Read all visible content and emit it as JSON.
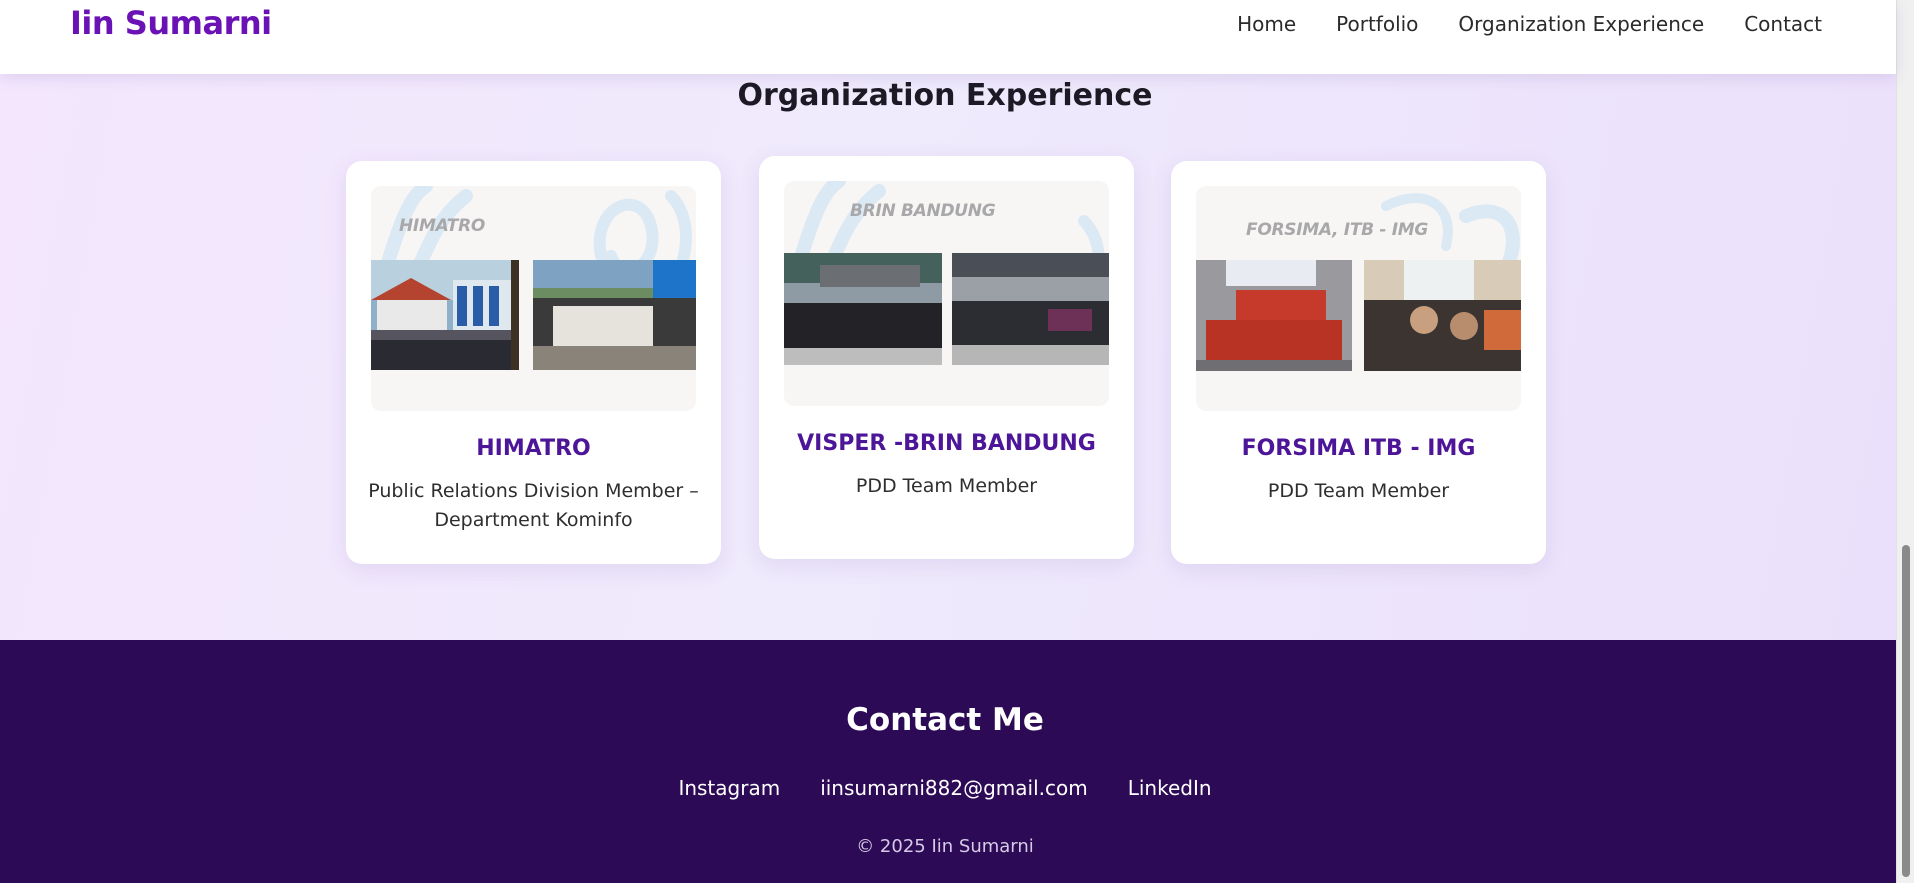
{
  "header": {
    "brand": "Iin Sumarni",
    "nav": [
      "Home",
      "Portfolio",
      "Organization Experience",
      "Contact"
    ]
  },
  "organization": {
    "title": "Organization Experience",
    "cards": [
      {
        "image_label": "HIMATRO",
        "title": "HIMATRO",
        "role": "Public Relations Division Member – Department Kominfo"
      },
      {
        "image_label": "BRIN BANDUNG",
        "title": "VISPER -BRIN BANDUNG",
        "role": "PDD Team Member"
      },
      {
        "image_label": "FORSIMA, ITB - IMG",
        "title": "FORSIMA ITB - IMG",
        "role": "PDD Team Member"
      }
    ]
  },
  "footer": {
    "title": "Contact Me",
    "links": [
      "Instagram",
      "iinsumarni882@gmail.com",
      "LinkedIn"
    ],
    "copyright": "© 2025 Iin Sumarni"
  },
  "colors": {
    "brand": "#6a12b5",
    "card_title": "#4d1597",
    "footer_bg": "#2d0a55"
  }
}
